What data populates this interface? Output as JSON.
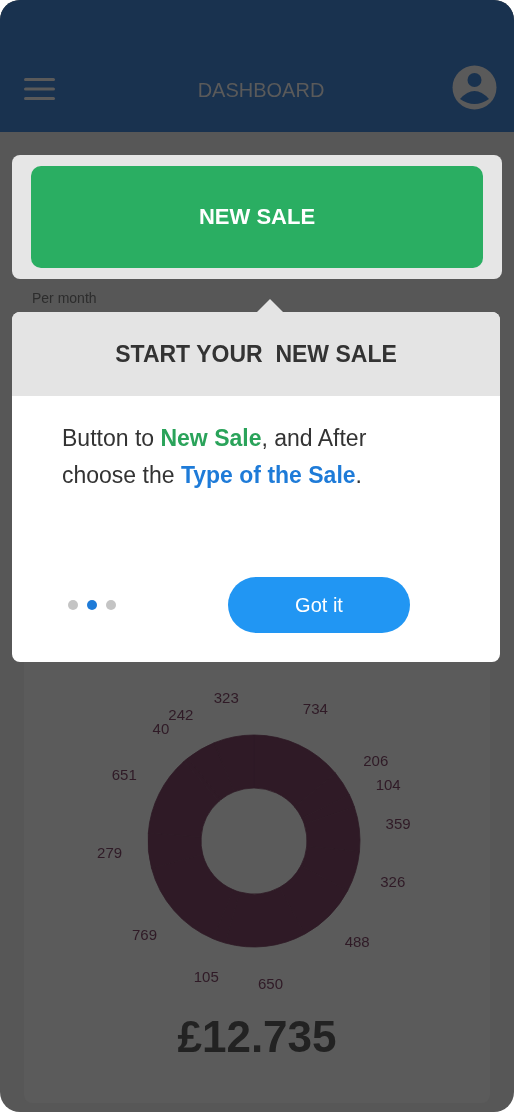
{
  "header": {
    "title": "DASHBOARD"
  },
  "new_sale_button": {
    "label": "NEW SALE"
  },
  "period_label": "Per month",
  "income_card": {
    "chart_data": {
      "type": "donut",
      "series": [
        {
          "color": "#2f1a26",
          "values": [
            734,
            206,
            104,
            359,
            326,
            488,
            650,
            105,
            769,
            279,
            651,
            40,
            242,
            323
          ]
        }
      ],
      "data_labels": true
    },
    "total": "£12.735"
  },
  "tour_popup": {
    "title": "START YOUR  NEW SALE",
    "message": "Button to **New Sale**, and After choose the **Type of the Sale**.",
    "pager": [
      {
        "selected": false
      },
      {
        "selected": true
      },
      {
        "selected": false
      }
    ],
    "button": "Got it"
  }
}
